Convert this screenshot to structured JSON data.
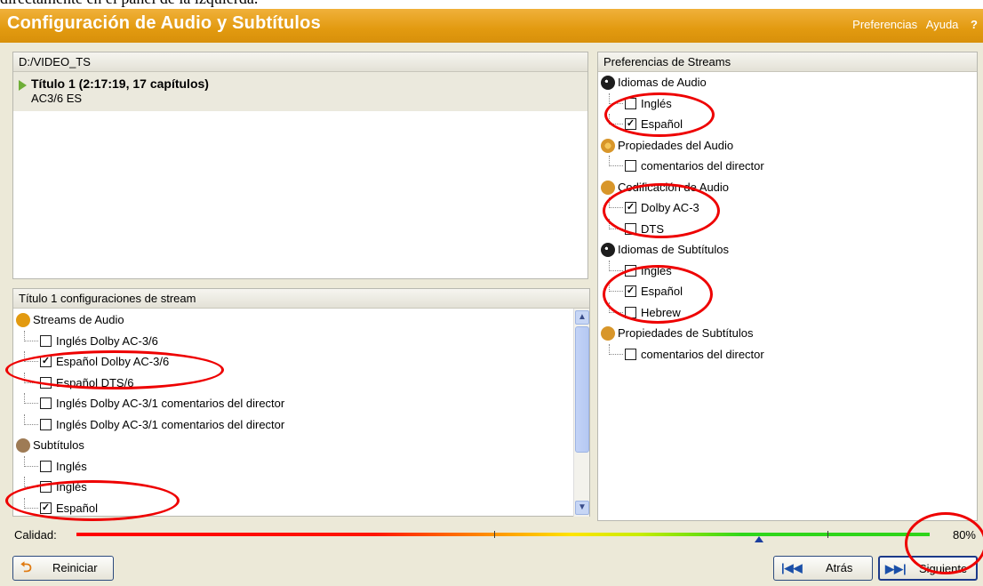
{
  "caption": "directamente en el panel de la izquierda.",
  "window": {
    "title": "Configuración de Audio y Subtítulos",
    "menu": [
      "Preferencias",
      "Ayuda"
    ],
    "help_q": "?"
  },
  "source_panel": {
    "path": "D:/VIDEO_TS",
    "title": {
      "name": "Título 1 (2:17:19, 17 capítulos)",
      "stream": "AC3/6 ES"
    }
  },
  "streams_panel": {
    "header": "Título 1 configuraciones de stream",
    "groups": [
      {
        "label": "Streams de Audio",
        "icon": "audio-streams-icon",
        "items": [
          {
            "label": "Inglés Dolby AC-3/6",
            "checked": false
          },
          {
            "label": "Español Dolby AC-3/6",
            "checked": true
          },
          {
            "label": "Español DTS/6",
            "checked": false
          },
          {
            "label": "Inglés Dolby AC-3/1 comentarios del director",
            "checked": false
          },
          {
            "label": "Inglés Dolby AC-3/1 comentarios del director",
            "checked": false
          }
        ]
      },
      {
        "label": "Subtítulos",
        "icon": "subtitles-icon",
        "items": [
          {
            "label": "Inglés",
            "checked": false
          },
          {
            "label": "Inglés",
            "checked": false
          },
          {
            "label": "Español",
            "checked": true
          }
        ]
      }
    ]
  },
  "prefs_panel": {
    "header": "Preferencias de Streams",
    "groups": [
      {
        "label": "Idiomas de Audio",
        "icon": "globe-icon",
        "items": [
          {
            "label": "Inglés",
            "checked": false
          },
          {
            "label": "Español",
            "checked": true
          }
        ]
      },
      {
        "label": "Propiedades del Audio",
        "icon": "audio-properties-icon",
        "items": [
          {
            "label": "comentarios del director",
            "checked": false
          }
        ]
      },
      {
        "label": "Codificación de Audio",
        "icon": "audio-codec-icon",
        "items": [
          {
            "label": "Dolby AC-3",
            "checked": true
          },
          {
            "label": "DTS",
            "checked": false
          }
        ]
      },
      {
        "label": "Idiomas de Subtítulos",
        "icon": "globe-icon",
        "items": [
          {
            "label": "Inglés",
            "checked": false
          },
          {
            "label": "Español",
            "checked": true
          },
          {
            "label": "Hebrew",
            "checked": false
          }
        ]
      },
      {
        "label": "Propiedades de Subtítulos",
        "icon": "subtitle-properties-icon",
        "items": [
          {
            "label": "comentarios del director",
            "checked": false
          }
        ]
      }
    ]
  },
  "quality": {
    "label": "Calidad:",
    "value_percent": 80,
    "value_text": "80%"
  },
  "buttons": {
    "reset": "Reiniciar",
    "back": "Atrás",
    "next": "Siguiente"
  },
  "colors": {
    "titlebar": "#e29a10",
    "annotation": "#ee0000",
    "quality_marker": "#1c3e9e"
  }
}
